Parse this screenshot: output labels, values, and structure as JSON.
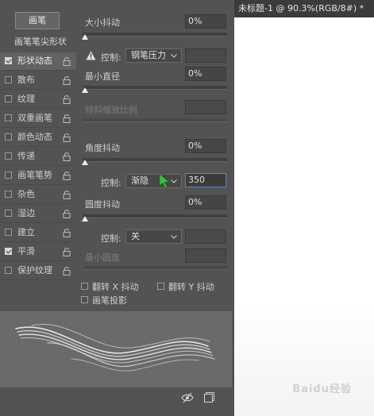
{
  "document": {
    "tab_title": "未标题-1 @ 90.3%(RGB/8#) *",
    "watermark": "Baidu经验"
  },
  "sidebar": {
    "brush_button": "画笔",
    "tip_shape": "画笔笔尖形状",
    "items": [
      {
        "label": "形状动态",
        "checked": true,
        "selected": true
      },
      {
        "label": "散布",
        "checked": false
      },
      {
        "label": "纹理",
        "checked": false
      },
      {
        "label": "双重画笔",
        "checked": false
      },
      {
        "label": "颜色动态",
        "checked": false
      },
      {
        "label": "传递",
        "checked": false
      },
      {
        "label": "画笔笔势",
        "checked": false
      },
      {
        "label": "杂色",
        "checked": false
      },
      {
        "label": "湿边",
        "checked": false
      },
      {
        "label": "建立",
        "checked": false
      },
      {
        "label": "平滑",
        "checked": true
      },
      {
        "label": "保护纹理",
        "checked": false
      }
    ]
  },
  "settings": {
    "size_jitter": {
      "label": "大小抖动",
      "value": "0%"
    },
    "control1": {
      "label": "控制:",
      "value": "钢笔压力"
    },
    "min_diameter": {
      "label": "最小直径",
      "value": "0%"
    },
    "tilt_scale": {
      "label": "倾斜缩放比例"
    },
    "angle_jitter": {
      "label": "角度抖动",
      "value": "0%"
    },
    "control2": {
      "label": "控制:",
      "value": "渐隐",
      "input": "350"
    },
    "roundness_jitter": {
      "label": "圆度抖动",
      "value": "0%"
    },
    "control3": {
      "label": "控制:",
      "value": "关"
    },
    "min_roundness": {
      "label": "最小圆度"
    },
    "flip_x": {
      "label": "翻转 X 抖动"
    },
    "flip_y": {
      "label": "翻转 Y 抖动"
    },
    "brush_projection": {
      "label": "画笔投影"
    }
  }
}
